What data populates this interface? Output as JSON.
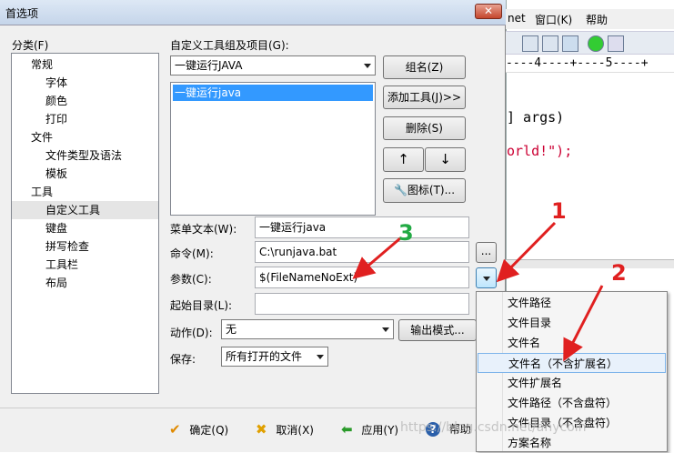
{
  "dialog": {
    "title": "首选项",
    "category_label": "分类(F)",
    "tree": [
      {
        "label": "常规",
        "level": 0
      },
      {
        "label": "字体",
        "level": 1
      },
      {
        "label": "颜色",
        "level": 1
      },
      {
        "label": "打印",
        "level": 1
      },
      {
        "label": "文件",
        "level": 0
      },
      {
        "label": "文件类型及语法",
        "level": 1
      },
      {
        "label": "模板",
        "level": 1
      },
      {
        "label": "工具",
        "level": 0
      },
      {
        "label": "自定义工具",
        "level": 1,
        "selected": true
      },
      {
        "label": "键盘",
        "level": 1
      },
      {
        "label": "拼写检查",
        "level": 1
      },
      {
        "label": "工具栏",
        "level": 1
      },
      {
        "label": "布局",
        "level": 1
      }
    ],
    "group_label": "自定义工具组及项目(G):",
    "group_value": "一键运行JAVA",
    "tool_list": [
      "一键运行java"
    ],
    "buttons": {
      "group_name": "组名(Z)",
      "add_tool": "添加工具(J)>>",
      "delete": "删除(S)",
      "up": "↑",
      "down": "↓",
      "icon": "图标(T)..."
    },
    "fields": {
      "menu_text_label": "菜单文本(W):",
      "menu_text_value": "一键运行java",
      "command_label": "命令(M):",
      "command_value": "C:\\runjava.bat",
      "args_label": "参数(C):",
      "args_value": "$(FileNameNoExt)",
      "start_dir_label": "起始目录(L):",
      "start_dir_value": "",
      "action_label": "动作(D):",
      "action_value": "无",
      "output_mode": "输出模式...",
      "save_label": "保存:",
      "save_value": "所有打开的文件",
      "browse": "..."
    },
    "footer": {
      "ok": "确定(Q)",
      "cancel": "取消(X)",
      "apply": "应用(Y)",
      "help": "帮助"
    }
  },
  "popup_menu": [
    {
      "label": "文件路径"
    },
    {
      "label": "文件目录"
    },
    {
      "label": "文件名"
    },
    {
      "label": "文件名（不含扩展名）",
      "highlighted": true
    },
    {
      "label": "文件扩展名"
    },
    {
      "label": "文件路径（不含盘符）"
    },
    {
      "label": "文件目录（不含盘符）"
    },
    {
      "label": "方案名称"
    }
  ],
  "editor": {
    "menu": [
      "net",
      "窗口(K)",
      "帮助"
    ],
    "ruler": "----4----+----5----+",
    "code_line1": "] args)",
    "code_line2": "orld!\");"
  },
  "annotations": {
    "n1": "1",
    "n2": "2",
    "n3": "3",
    "red": "#e02020",
    "green": "#22aa44"
  },
  "watermark": "https://blog.csdn.net/anycoin"
}
